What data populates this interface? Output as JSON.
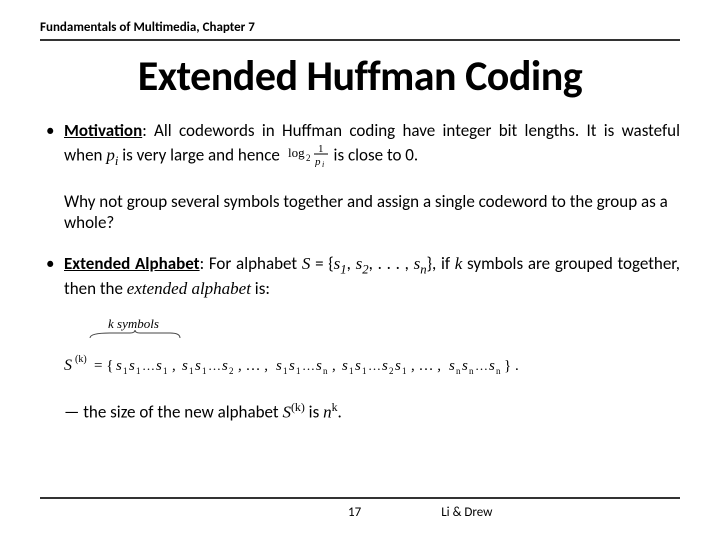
{
  "header": {
    "chapter": "Fundamentals of Multimedia, Chapter 7"
  },
  "title": "Extended Huffman Coding",
  "motivation": {
    "label": "Motivation",
    "text_a": ": All codewords in Huffman coding have integer bit lengths. It is wasteful when ",
    "pi": "p",
    "pi_sub": "i",
    "text_b": " is very large and hence ",
    "log_expr": "log₂ 1/pᵢ",
    "text_c": " is close to 0.",
    "why": "Why not group several symbols together and assign a single codeword to the group as a whole?"
  },
  "extended": {
    "label": "Extended Alphabet",
    "text_a": ": For alphabet ",
    "S": "S",
    "eq": " = {",
    "s1": "s",
    "s1_sub": "1",
    "sep": ", ",
    "s2": "s",
    "s2_sub": "2",
    "dots": ", . . . , ",
    "sn": "s",
    "sn_sub": "n",
    "close": "}, if ",
    "k": "k",
    "text_b": " symbols are grouped together, then the ",
    "ea": "extended alphabet",
    "text_c": " is:",
    "k_symbols_label": "k symbols",
    "set_formula": "S⁽ᵏ⁾ = { s₁s₁…s₁ , s₁s₁…s₂ , … , s₁s₁…sₙ , s₁s₁…s₂s₁ , … , sₙsₙ…sₙ } .",
    "size_a": "— the size of the new alphabet ",
    "Sk": "S",
    "Sk_sup": "(k)",
    "size_b": " is ",
    "nk": "n",
    "nk_sup": "k",
    "size_c": "."
  },
  "footer": {
    "page": "17",
    "authors": "Li & Drew"
  }
}
